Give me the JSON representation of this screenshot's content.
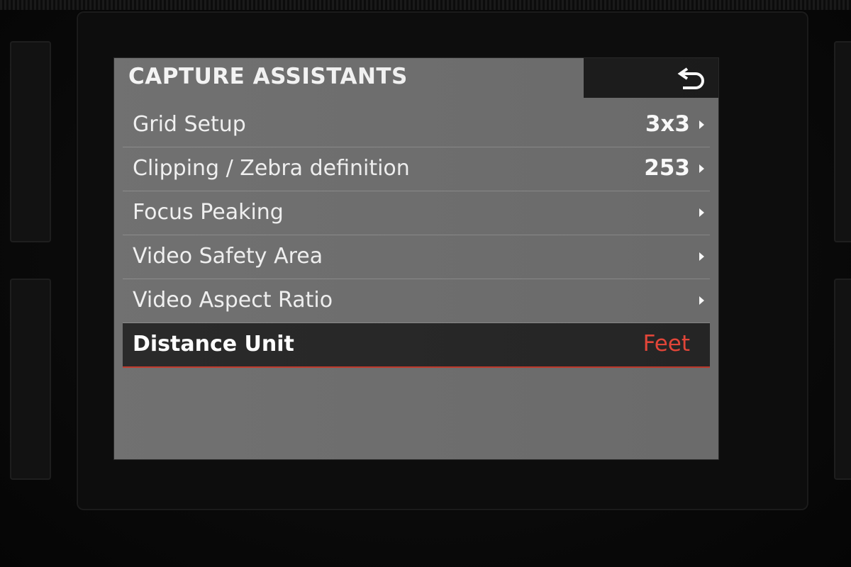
{
  "screen": {
    "title": "CAPTURE ASSISTANTS",
    "back_icon": "back-arrow-icon"
  },
  "menu": {
    "items": [
      {
        "label": "Grid Setup",
        "value": "3x3",
        "has_submenu": true,
        "selected": false
      },
      {
        "label": "Clipping / Zebra definition",
        "value": "253",
        "has_submenu": true,
        "selected": false
      },
      {
        "label": "Focus Peaking",
        "value": "",
        "has_submenu": true,
        "selected": false
      },
      {
        "label": "Video Safety Area",
        "value": "",
        "has_submenu": true,
        "selected": false
      },
      {
        "label": "Video Aspect Ratio",
        "value": "",
        "has_submenu": true,
        "selected": false
      },
      {
        "label": "Distance Unit",
        "value": "Feet",
        "has_submenu": false,
        "selected": true
      }
    ]
  },
  "colors": {
    "screen_background": "#6e6e6e",
    "selected_row": "#262626",
    "selected_value": "#e8473a",
    "header_back_area": "#1c1c1c"
  }
}
